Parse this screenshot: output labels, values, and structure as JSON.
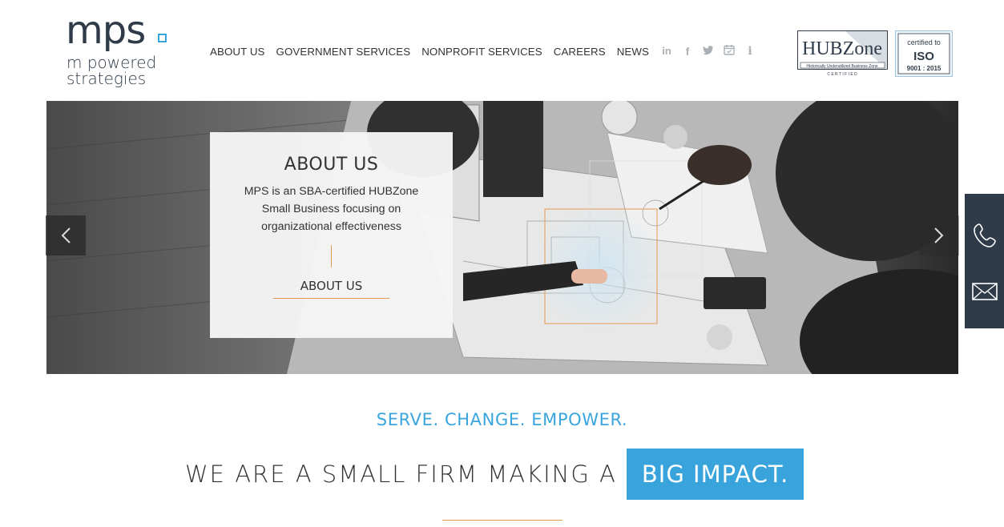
{
  "logo": {
    "mark": "mps",
    "line1": "m powered",
    "line2": "strategies"
  },
  "nav": {
    "items": [
      {
        "label": "ABOUT US"
      },
      {
        "label": "GOVERNMENT SERVICES"
      },
      {
        "label": "NONPROFIT SERVICES"
      },
      {
        "label": "CAREERS"
      },
      {
        "label": "NEWS"
      }
    ]
  },
  "social": [
    "linkedin-icon",
    "facebook-icon",
    "twitter-icon",
    "calendar-icon",
    "info-icon"
  ],
  "badges": {
    "hubzone_title": "HUBZone",
    "hubzone_sub": "Historically Underutilized Business Zone",
    "hubzone_cert": "C E R T I F I E D",
    "iso_top": "certified to",
    "iso_main": "ISO",
    "iso_num": "9001 : 2015"
  },
  "hero": {
    "card_title": "ABOUT US",
    "card_text": "MPS is an SBA-certified HUBZone Small Business focusing on organizational effectiveness",
    "card_button": "ABOUT US"
  },
  "tagline": "SERVE. CHANGE. EMPOWER.",
  "headline": {
    "plain": "WE ARE A SMALL FIRM MAKING A",
    "highlight": "BIG IMPACT."
  },
  "colors": {
    "accent_blue": "#39a3dc",
    "accent_orange": "#e39a55",
    "dark_navy": "#2f3b48"
  }
}
